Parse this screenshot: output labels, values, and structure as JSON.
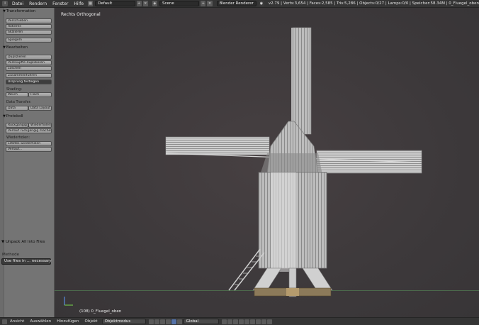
{
  "topbar": {
    "editor_icon": "info-editor-icon",
    "menus": [
      "Datei",
      "Rendern",
      "Fenster",
      "Hilfe"
    ],
    "layout": "Default",
    "scene": "Scene",
    "engine": "Blender Renderer",
    "stats": "v2.79 | Verts:3,654 | Faces:2,585 | Tris:5,286 | Objects:0/27 | Lamps:0/0 | Speicher:58.34M | 0_Fluegel_oben"
  },
  "toolshelf": {
    "transform_header": "Transformation",
    "transform_buttons": [
      "Verschieben",
      "Rotieren",
      "Skalieren",
      "Spiegeln"
    ],
    "edit_header": "Bearbeiten",
    "edit_buttons": [
      "Duplizieren",
      "Verknüpfte duplizieren",
      "Löschen",
      "Zusammenführen"
    ],
    "origin_select": "Ursprung festlegen",
    "shading_label": "Shading:",
    "shading_buttons": [
      "Weich",
      "Flach"
    ],
    "datatransfer_label": "Data Transfer:",
    "datatransfer_buttons": [
      "Data",
      "Data Layout"
    ],
    "history_header": "Protokoll",
    "history_buttons": [
      "Rückgängig",
      "Wiederholen"
    ],
    "history_undo_list": "Verlauf rückgängig machen",
    "repeat_label": "Wiederholen:",
    "repeat_buttons": [
      "Letztes wiederholen",
      "Verlauf..."
    ]
  },
  "operator": {
    "title": "Unpack All Into Files",
    "method_label": "Methode",
    "method_value": "Use files in ... necessary"
  },
  "viewport": {
    "view_name": "Rechts Orthogonal",
    "object_label": "(108) 0_Fluegel_oben"
  },
  "bottombar": {
    "menus": [
      "Ansicht",
      "Auswählen",
      "Hinzufügen",
      "Objekt"
    ],
    "mode": "Objektmodus",
    "orientation": "Global"
  }
}
